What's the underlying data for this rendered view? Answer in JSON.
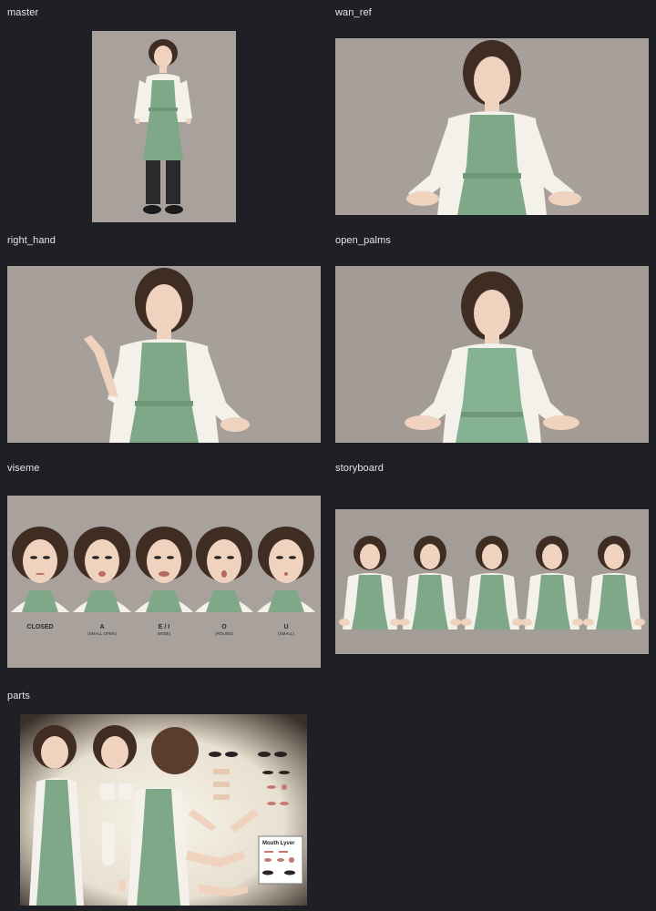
{
  "gallery": {
    "items": [
      {
        "label": "master"
      },
      {
        "label": "wan_ref"
      },
      {
        "label": "right_hand"
      },
      {
        "label": "open_palms"
      },
      {
        "label": "viseme"
      },
      {
        "label": "storyboard"
      },
      {
        "label": "parts"
      }
    ]
  },
  "viseme_sheet": {
    "shapes": [
      {
        "name": "CLOSED",
        "desc": ""
      },
      {
        "name": "A",
        "desc": "(SMALL OPEN)"
      },
      {
        "name": "E / I",
        "desc": "(WIDE)"
      },
      {
        "name": "O",
        "desc": "(ROUND)"
      },
      {
        "name": "U",
        "desc": "(SMALL)"
      }
    ]
  },
  "parts_sheet": {
    "panel_title": "Mouth Lyver"
  },
  "colors": {
    "page_bg": "#1f2025",
    "canvas_bg": "#a69f9a",
    "apron": "#7fa889",
    "hair": "#3f2c22",
    "skin": "#f0d3bf",
    "shirt": "#f3f1ea"
  }
}
